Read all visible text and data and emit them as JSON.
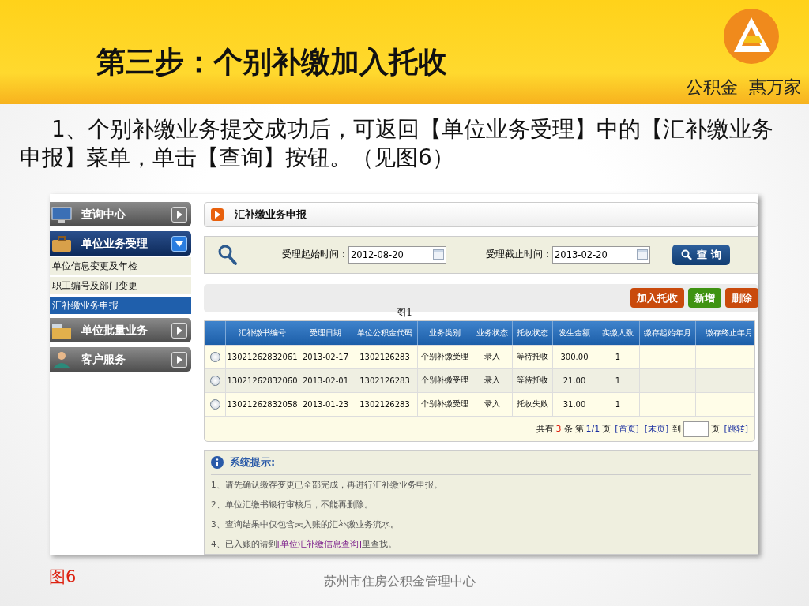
{
  "slide": {
    "title": "第三步：个别补缴加入托收",
    "tagline": "公积金  惠万家",
    "intro": "1、个别补缴业务提交成功后，可返回【单位业务受理】中的【汇补缴业务申报】菜单，单击【查询】按钮。（见图6）",
    "figure_label": "图6",
    "footer": "苏州市住房公积金管理中心"
  },
  "sidebar": [
    {
      "label": "查询中心",
      "expanded": false
    },
    {
      "label": "单位业务受理",
      "expanded": true,
      "items": [
        {
          "label": "单位信息变更及年检",
          "selected": false
        },
        {
          "label": "职工编号及部门变更",
          "selected": false
        },
        {
          "label": "汇补缴业务申报",
          "selected": true
        }
      ]
    },
    {
      "label": "单位批量业务",
      "expanded": false
    },
    {
      "label": "客户服务",
      "expanded": false
    }
  ],
  "panel_title": "汇补缴业务申报",
  "search": {
    "start_label": "受理起始时间：",
    "start_value": "2012-08-20",
    "end_label": "受理截止时间：",
    "end_value": "2013-02-20",
    "button": "查 询"
  },
  "actions": [
    {
      "label": "加入托收",
      "color": "#c94a0c"
    },
    {
      "label": "新增",
      "color": "#3f9312"
    },
    {
      "label": "删除",
      "color": "#c94a0c"
    }
  ],
  "overlay_caption": "图1",
  "table": {
    "columns": [
      "汇补缴书编号",
      "受理日期",
      "单位公积金代码",
      "业务类别",
      "业务状态",
      "托收状态",
      "发生金额",
      "实缴人数",
      "缴存起始年月",
      "缴存终止年月"
    ],
    "rows": [
      {
        "selected": false,
        "cells": [
          "13021262832061",
          "2013-02-17",
          "1302126283",
          "个别补缴受理",
          "录入",
          "等待托收",
          "300.00",
          "1",
          "",
          ""
        ]
      },
      {
        "selected": false,
        "cells": [
          "13021262832060",
          "2013-02-01",
          "1302126283",
          "个别补缴受理",
          "录入",
          "等待托收",
          "21.00",
          "1",
          "",
          ""
        ]
      },
      {
        "selected": false,
        "cells": [
          "13021262832058",
          "2013-01-23",
          "1302126283",
          "个别补缴受理",
          "录入",
          "托收失败",
          "31.00",
          "1",
          "",
          ""
        ]
      }
    ]
  },
  "pager": {
    "total_prefix": "共有",
    "total_count": "3",
    "total_suffix": "条",
    "page_prefix": "第",
    "page": "1/1",
    "page_suffix": "页",
    "first": "[首页]",
    "last": "[末页]",
    "goto_prefix": "到",
    "goto_suffix": "页",
    "jump": "[跳转]"
  },
  "notes": {
    "title": "系统提示:",
    "items": [
      {
        "kind": "text",
        "text": "1、请先确认缴存变更已全部完成，再进行汇补缴业务申报。"
      },
      {
        "kind": "text",
        "text": "2、单位汇缴书银行审核后，不能再删除。"
      },
      {
        "kind": "text",
        "text": "3、查询结果中仅包含未入账的汇补缴业务流水。"
      },
      {
        "kind": "link",
        "before": "4、已入账的请到",
        "link": "[单位汇补缴信息查询]",
        "after": "里查找。"
      }
    ]
  }
}
